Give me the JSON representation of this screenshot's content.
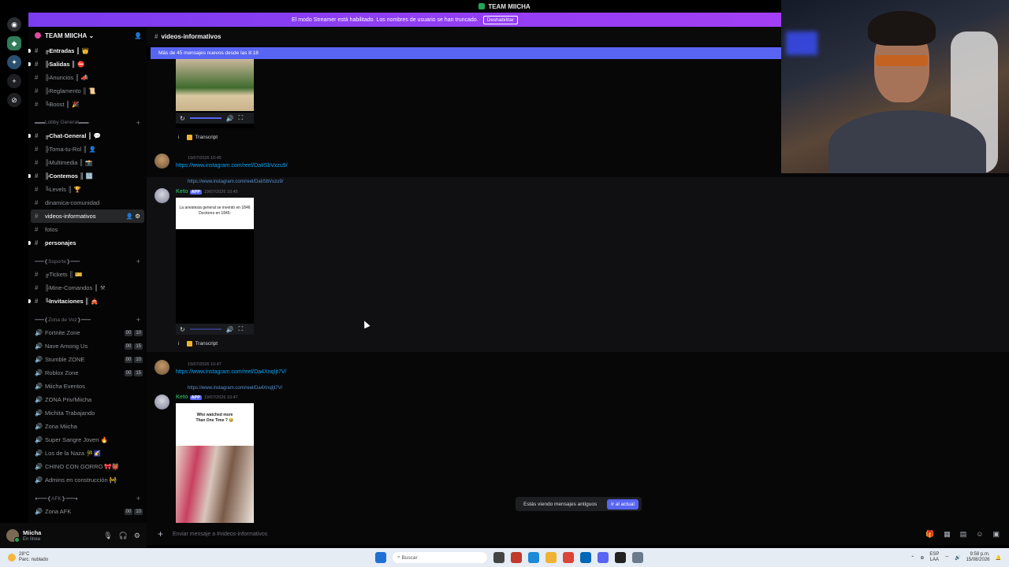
{
  "window": {
    "title": "TEAM MIICHA"
  },
  "streamer_banner": {
    "text": "El modo Streamer está habilitado. Los nombres de usuario se han truncado.",
    "button": "Deshabilitar"
  },
  "server": {
    "name": "TEAM MIICHA"
  },
  "channel_header": {
    "name": "videos-informativos"
  },
  "new_messages_bar": "Más de 45 mensajes nuevos desde las 8:18",
  "sidebar": {
    "channels_top": [
      {
        "label": "╔Entradas ║ 👑",
        "unread": true
      },
      {
        "label": "╠Salidas ║ ⛔",
        "unread": true
      },
      {
        "label": "╠Anuncios ║ 📣",
        "unread": false
      },
      {
        "label": "╠Reglamento ║ 📜",
        "unread": false
      },
      {
        "label": "╚Boost ║ 🎉",
        "unread": false
      }
    ],
    "cat_lobby": "▬▬Lobby General▬▬",
    "channels_lobby": [
      {
        "label": "╔Chat-General ║ 💬",
        "unread": true
      },
      {
        "label": "╠Toma-tu-Rol ║ 👤",
        "unread": false
      },
      {
        "label": "╠Multimedia ║ 📸",
        "unread": false
      },
      {
        "label": "╠Contemos ║ 🔢",
        "unread": true
      },
      {
        "label": "╚Levels ║ 🏆",
        "unread": false
      },
      {
        "label": "dinamica-comunidad",
        "unread": false
      },
      {
        "label": "videos-informativos",
        "unread": false,
        "active": true
      },
      {
        "label": "fotos",
        "unread": false
      },
      {
        "label": "personajes",
        "unread": true
      }
    ],
    "cat_soporte": "━━━❰Soporte❱━━━",
    "channels_soporte": [
      {
        "label": "╔Tickets ║ 🎫",
        "unread": false
      },
      {
        "label": "╠Mine-Comandos ║ ⚒",
        "unread": false
      },
      {
        "label": "╚Invitaciones ║ 🎪",
        "unread": true
      }
    ],
    "cat_voz": "━━━❰Zona de Voz❱━━━",
    "voice": [
      {
        "label": "Fortnite Zone",
        "badges": [
          "00",
          "10"
        ]
      },
      {
        "label": "Nave Among Us",
        "badges": [
          "00",
          "15"
        ]
      },
      {
        "label": "Stumble ZONE",
        "badges": [
          "00",
          "10"
        ]
      },
      {
        "label": "Roblox Zone",
        "badges": [
          "00",
          "15"
        ]
      },
      {
        "label": "Miicha Eventos",
        "badges": []
      },
      {
        "label": "ZONA Priv/Miicha",
        "badges": []
      },
      {
        "label": "Michita Trabajando",
        "badges": []
      },
      {
        "label": "Zona Miicha",
        "badges": []
      },
      {
        "label": "Super Sangre Joven 🔥",
        "badges": []
      },
      {
        "label": "Los de la Naza 🎋🌠",
        "badges": []
      },
      {
        "label": "CHINO CON GORRO 🎀👹",
        "badges": []
      },
      {
        "label": "Admins en construcción 🚧",
        "badges": []
      }
    ],
    "cat_afk": "●━━━❰AFK❱━━━●",
    "voice_afk": [
      {
        "label": "Zona AFK",
        "badges": [
          "00",
          "10"
        ]
      }
    ]
  },
  "user": {
    "name": "Miicha",
    "status": "En línea"
  },
  "messages": {
    "m1": {
      "time": "19/07/2026 10:45",
      "link": "https://www.instagram.com/reel/DaIiSbVxzu9/"
    },
    "m2": {
      "reply_link": "https://www.instagram.com/reel/DaIiSbVxzu9/",
      "author": "Keto",
      "app": "APP",
      "time": "19/07/2026 10:45",
      "video_caption_1": "La anestesia general se inventó en 1846",
      "video_caption_2": "Doctores en 1845:"
    },
    "m3": {
      "time": "19/07/2026 10:47",
      "link": "https://www.instagram.com/reel/Da4XnqIjt7V/"
    },
    "m4": {
      "reply_link": "https://www.instagram.com/reel/Da4XnqIjt7V/",
      "author": "Keto",
      "app": "APP",
      "time": "19/07/2026 10:47",
      "video_caption": "Who watched more Than One Time ? 😂"
    },
    "info_btn": "i",
    "transcript": "Transcript"
  },
  "jump_pill": {
    "text": "Estás viendo mensajes antiguos",
    "button": "Ir al actual"
  },
  "composer": {
    "placeholder": "Enviar mensaje a #videos-informativos"
  },
  "taskbar": {
    "temp": "28°C",
    "weather": "Parc. nublado",
    "search": "Buscar",
    "lang1": "ESP",
    "lang2": "LAA",
    "time": "9:58 p.m.",
    "date": "15/08/2026"
  }
}
